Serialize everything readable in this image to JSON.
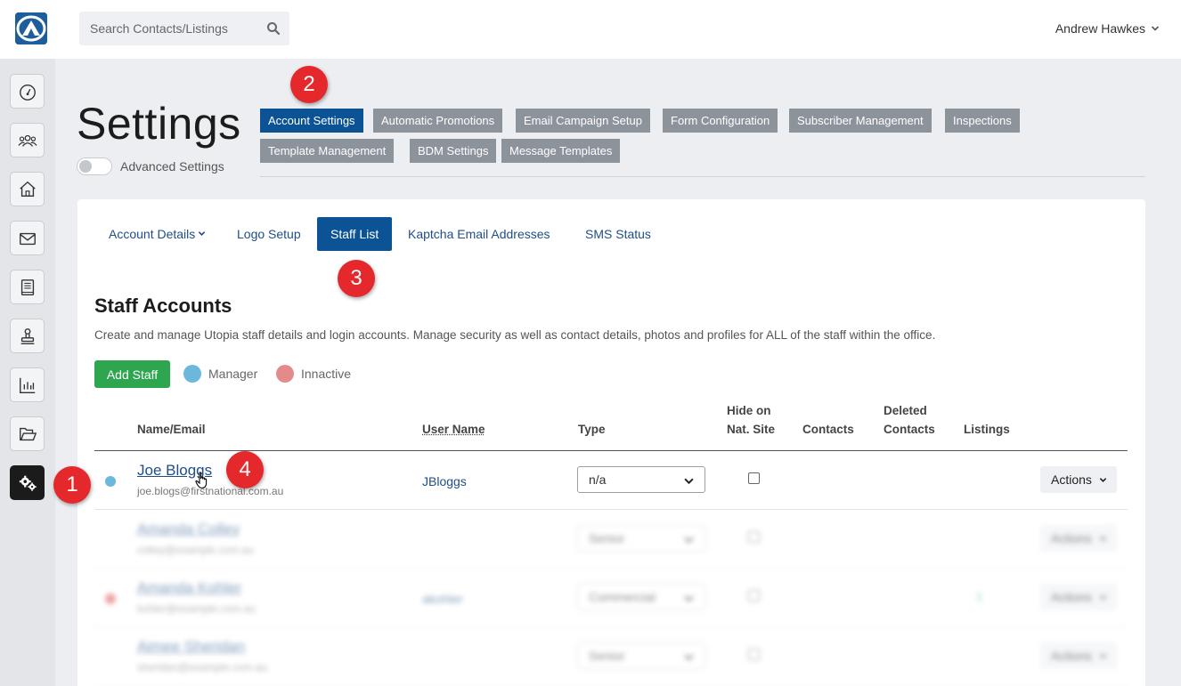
{
  "header": {
    "search_placeholder": "Search Contacts/Listings",
    "user_name": "Andrew Hawkes"
  },
  "sidebar": {
    "items": [
      {
        "icon": "dashboard-icon"
      },
      {
        "icon": "contacts-icon"
      },
      {
        "icon": "home-icon"
      },
      {
        "icon": "mail-icon"
      },
      {
        "icon": "book-icon"
      },
      {
        "icon": "stamp-icon"
      },
      {
        "icon": "chart-icon"
      },
      {
        "icon": "folder-icon"
      },
      {
        "icon": "settings-gears-icon",
        "active": true
      }
    ]
  },
  "page": {
    "title": "Settings",
    "advanced_toggle_label": "Advanced Settings",
    "advanced_toggle_on": false
  },
  "settings_tabs": [
    {
      "label": "Account Settings",
      "active": true
    },
    {
      "label": "Automatic Promotions"
    },
    {
      "label": "Email Campaign Setup"
    },
    {
      "label": "Form Configuration"
    },
    {
      "label": "Subscriber Management"
    },
    {
      "label": "Inspections"
    },
    {
      "label": "Template Management"
    },
    {
      "label": "BDM Settings"
    },
    {
      "label": "Message Templates"
    }
  ],
  "sub_tabs": [
    {
      "label": "Account Details"
    },
    {
      "label": "Logo Setup"
    },
    {
      "label": "Staff List",
      "active": true
    },
    {
      "label": "Kaptcha Email Addresses"
    },
    {
      "label": "SMS Status"
    }
  ],
  "staff": {
    "title": "Staff Accounts",
    "description": "Create and manage Utopia staff details and login accounts. Manage security as well as contact details, photos and profiles for ALL of the staff within the office.",
    "add_button": "Add Staff",
    "legend": [
      {
        "label": "Manager",
        "color": "#6cb8dd"
      },
      {
        "label": "Innactive",
        "color": "#e48a8a"
      }
    ],
    "columns": {
      "name": "Name/Email",
      "username": "User Name",
      "type": "Type",
      "hide_line1": "Hide on",
      "hide_line2": "Nat. Site",
      "contacts": "Contacts",
      "deleted_line1": "Deleted",
      "deleted_line2": "Contacts",
      "listings": "Listings"
    },
    "rows": [
      {
        "name": "Joe Bloggs",
        "email": "joe.blogs@firstnational.com.au",
        "username": "JBloggs",
        "type": "n/a",
        "actions": "Actions",
        "status_color": "#6cb8dd"
      },
      {
        "name": "Amanda Colley",
        "email": "colley@example.com.au",
        "username": "",
        "type": "Senior",
        "actions": "Actions",
        "status_color": ""
      },
      {
        "name": "Amanda Kohler",
        "email": "kohler@example.com.au",
        "username": "akohler",
        "type": "Commercial",
        "actions": "Actions",
        "status_color": "#e05555",
        "listings": "1"
      },
      {
        "name": "Aimee Sheridan",
        "email": "sheridan@example.com.au",
        "username": "",
        "type": "Senior",
        "actions": "Actions",
        "status_color": ""
      }
    ]
  },
  "annotations": [
    "1",
    "2",
    "3",
    "4"
  ]
}
